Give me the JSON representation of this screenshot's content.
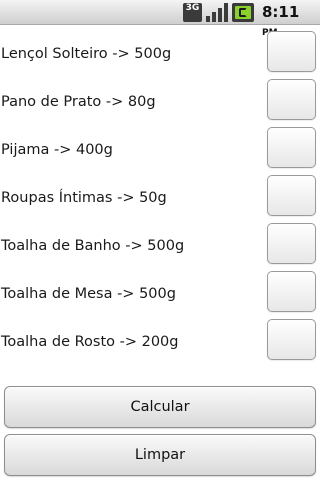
{
  "status_bar": {
    "network": "3G",
    "time": "8:11",
    "ampm": "PM",
    "icons": [
      "3g-icon",
      "signal-icon",
      "battery-icon"
    ]
  },
  "items": [
    {
      "label": "Lençol Solteiro -> 500g",
      "checked": false
    },
    {
      "label": "Pano de Prato -> 80g",
      "checked": false
    },
    {
      "label": "Pijama -> 400g",
      "checked": false
    },
    {
      "label": "Roupas Íntimas -> 50g",
      "checked": false
    },
    {
      "label": "Toalha de Banho -> 500g",
      "checked": false
    },
    {
      "label": "Toalha de Mesa -> 500g",
      "checked": false
    },
    {
      "label": "Toalha de Rosto -> 200g",
      "checked": false
    }
  ],
  "buttons": {
    "calcular": "Calcular",
    "limpar": "Limpar"
  }
}
